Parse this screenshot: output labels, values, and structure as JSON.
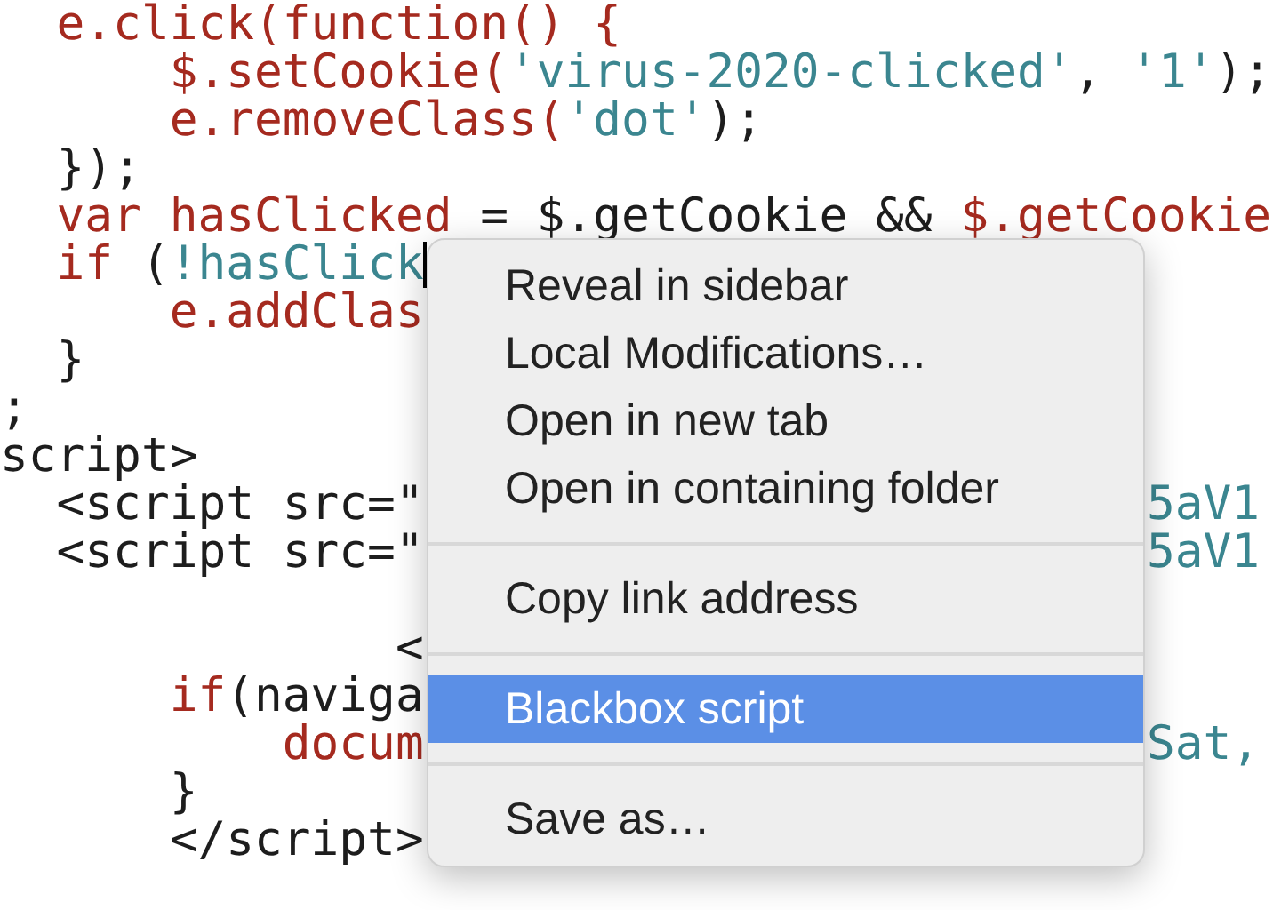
{
  "code_lines": [
    {
      "kind": "code",
      "segments": [
        {
          "kind": "keyword",
          "text": "  e.click(function() {"
        }
      ]
    },
    {
      "kind": "code",
      "segments": [
        {
          "kind": "keyword",
          "text": "      $.setCookie("
        },
        {
          "kind": "string",
          "text": "'virus-2020-clicked'"
        },
        {
          "kind": "plain",
          "text": ", "
        },
        {
          "kind": "string",
          "text": "'1'"
        },
        {
          "kind": "plain",
          "text": ");"
        }
      ]
    },
    {
      "kind": "code",
      "segments": [
        {
          "kind": "keyword",
          "text": "      e.removeClass("
        },
        {
          "kind": "string",
          "text": "'dot'"
        },
        {
          "kind": "plain",
          "text": ");"
        }
      ]
    },
    {
      "kind": "code",
      "segments": [
        {
          "kind": "plain",
          "text": "  });"
        }
      ]
    },
    {
      "kind": "code",
      "segments": [
        {
          "kind": "keyword",
          "text": "  var hasClicked"
        },
        {
          "kind": "plain",
          "text": " = $.getCookie && "
        },
        {
          "kind": "keyword",
          "text": "$.getCookie"
        }
      ]
    },
    {
      "kind": "code",
      "segments": [
        {
          "kind": "keyword",
          "text": "  if"
        },
        {
          "kind": "plain",
          "text": " ("
        },
        {
          "kind": "string",
          "text": "!hasClick"
        }
      ],
      "cursor": true
    },
    {
      "kind": "code",
      "segments": [
        {
          "kind": "keyword",
          "text": "      e.addClas"
        }
      ]
    },
    {
      "kind": "code",
      "segments": [
        {
          "kind": "plain",
          "text": "  }"
        }
      ]
    },
    {
      "kind": "code",
      "segments": [
        {
          "kind": "plain",
          "text": ";"
        }
      ]
    },
    {
      "kind": "code",
      "segments": [
        {
          "kind": "plain",
          "text": "script>"
        }
      ]
    },
    {
      "kind": "code",
      "segments": [
        {
          "kind": "plain",
          "text": "  <script src=\""
        }
      ],
      "right": [
        {
          "kind": "string",
          "text": "5aV1"
        }
      ]
    },
    {
      "kind": "code",
      "segments": [
        {
          "kind": "plain",
          "text": "  <script src=\""
        }
      ],
      "right": [
        {
          "kind": "string",
          "text": "5aV1"
        }
      ]
    },
    {
      "kind": "blank"
    },
    {
      "kind": "code",
      "segments": [
        {
          "kind": "plain",
          "text": "              <"
        }
      ]
    },
    {
      "kind": "code",
      "segments": [
        {
          "kind": "keyword",
          "text": "      if"
        },
        {
          "kind": "plain",
          "text": "(naviga"
        }
      ]
    },
    {
      "kind": "code",
      "segments": [
        {
          "kind": "keyword",
          "text": "          docum"
        }
      ],
      "right": [
        {
          "kind": "string",
          "text": "Sat,"
        }
      ]
    },
    {
      "kind": "code",
      "segments": [
        {
          "kind": "plain",
          "text": "      }"
        }
      ]
    },
    {
      "kind": "code",
      "segments": [
        {
          "kind": "plain",
          "text": "      </script>"
        }
      ]
    }
  ],
  "context_menu": [
    {
      "kind": "item",
      "label": "Reveal in sidebar",
      "selected": false
    },
    {
      "kind": "item",
      "label": "Local Modifications…",
      "selected": false
    },
    {
      "kind": "item",
      "label": "Open in new tab",
      "selected": false
    },
    {
      "kind": "item",
      "label": "Open in containing folder",
      "selected": false
    },
    {
      "kind": "separator"
    },
    {
      "kind": "item",
      "label": "Copy link address",
      "selected": false
    },
    {
      "kind": "separator"
    },
    {
      "kind": "item",
      "label": "Blackbox script",
      "selected": true
    },
    {
      "kind": "separator"
    },
    {
      "kind": "item",
      "label": "Save as…",
      "selected": false
    }
  ]
}
